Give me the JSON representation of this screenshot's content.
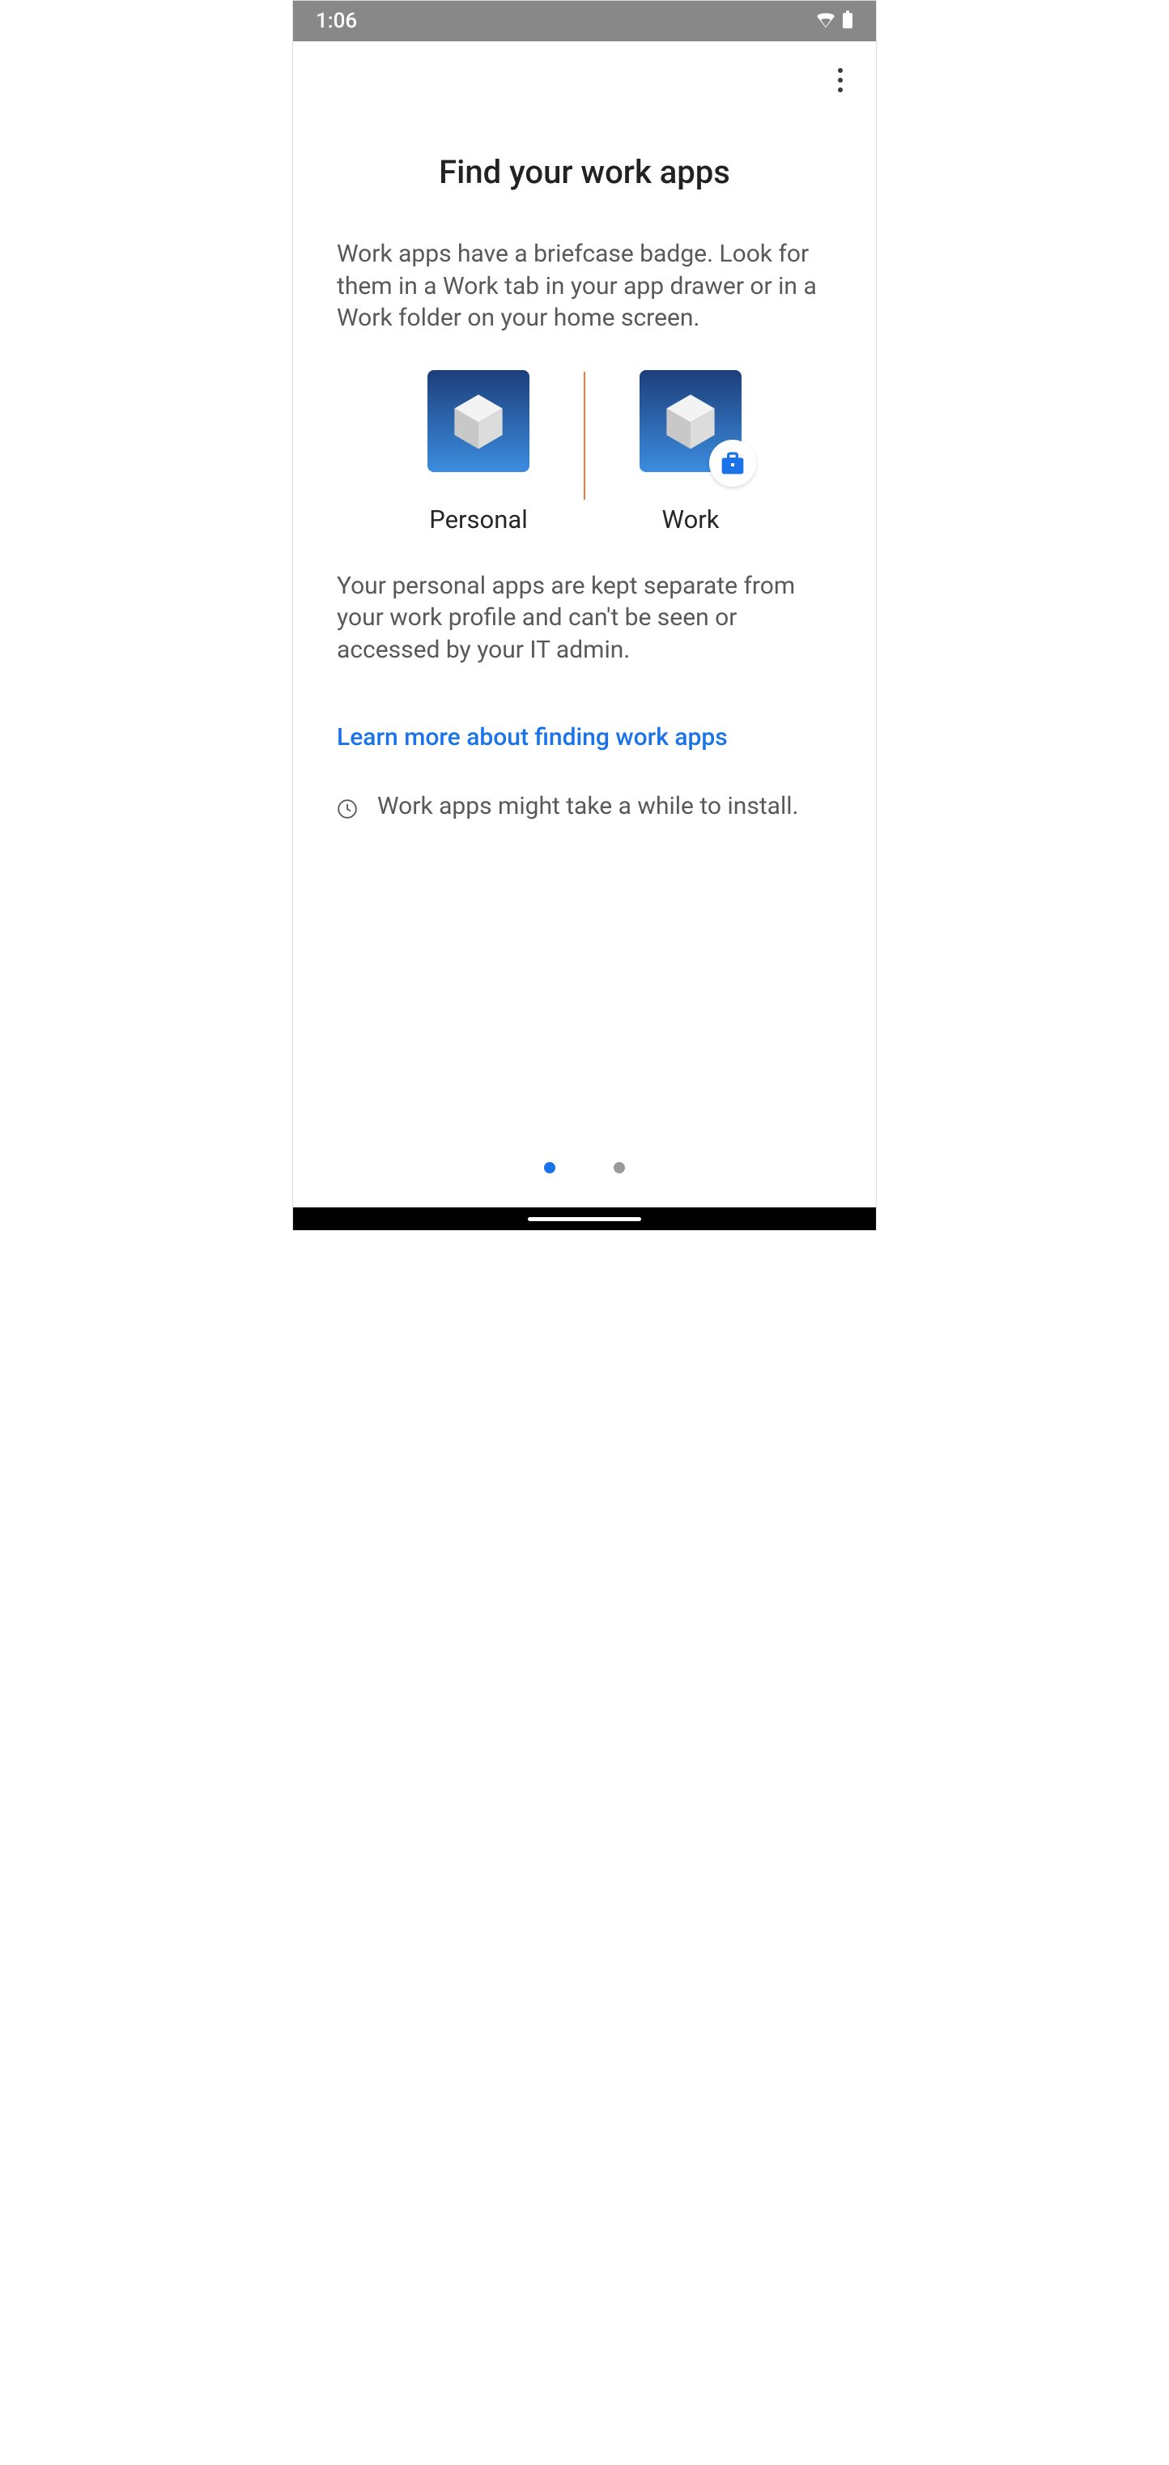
{
  "status": {
    "time": "1:06"
  },
  "main": {
    "title": "Find your work apps",
    "para1": "Work apps have a briefcase badge. Look for them in a Work tab in your app drawer or in a Work folder on your home screen.",
    "personal_label": "Personal",
    "work_label": "Work",
    "para2": "Your personal apps are kept separate from your work profile and can't be seen or accessed by your IT admin.",
    "link": "Learn more about finding work apps",
    "note": "Work apps might take a while to install."
  }
}
